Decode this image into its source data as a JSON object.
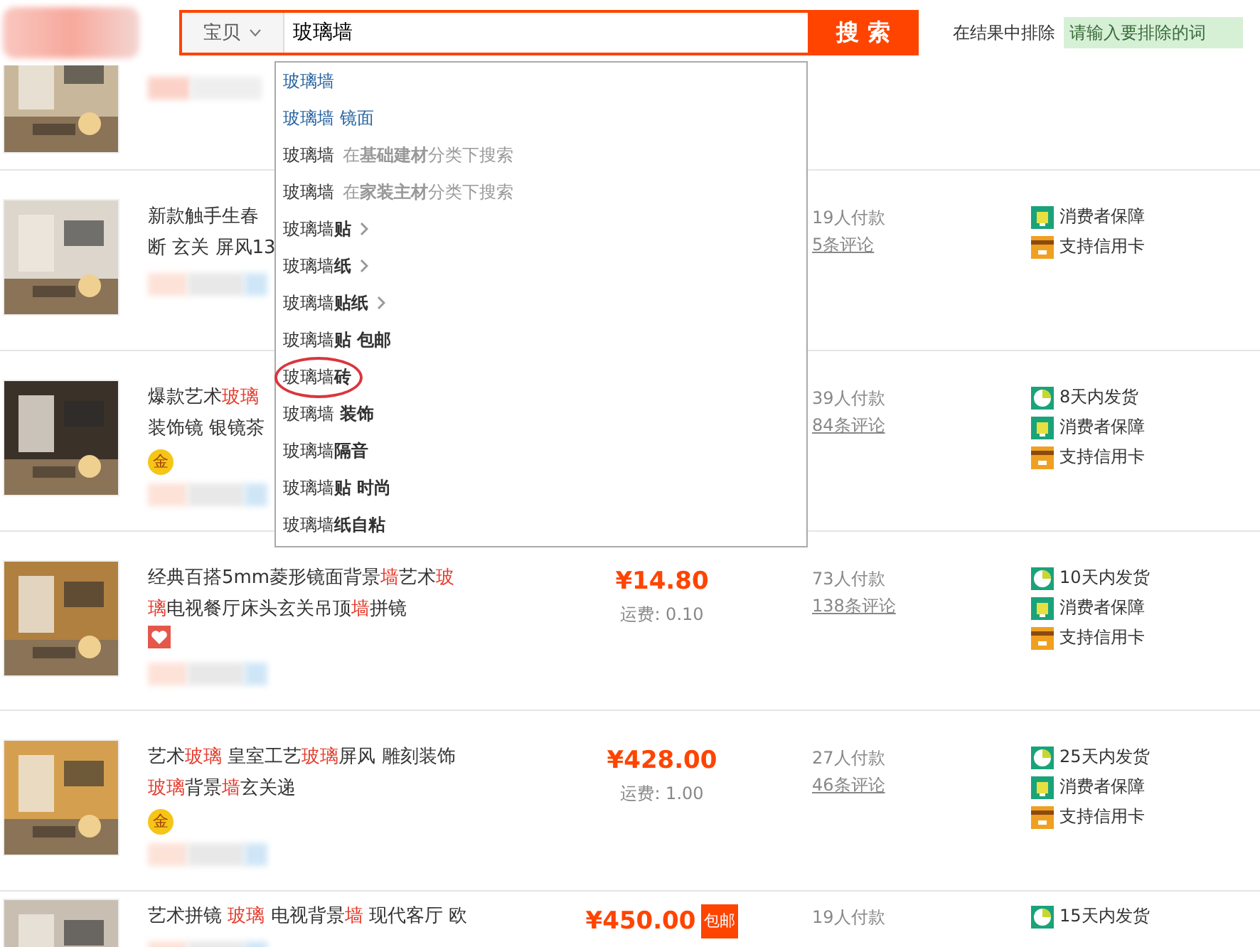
{
  "search": {
    "scope": "宝贝",
    "value": "玻璃墙",
    "button": "搜 索",
    "exclude_label": "在结果中排除",
    "exclude_placeholder": "请输入要排除的词"
  },
  "suggestions": [
    {
      "kind": "history",
      "text": "玻璃墙",
      "arrow": false,
      "circled": false
    },
    {
      "kind": "history",
      "text": "玻璃墙 镜面",
      "arrow": false,
      "circled": false
    },
    {
      "kind": "category",
      "text": "玻璃墙",
      "note": "在**基础建材**分类下搜索",
      "arrow": false,
      "circled": false
    },
    {
      "kind": "category",
      "text": "玻璃墙",
      "note": "在**家装主材**分类下搜索",
      "arrow": false,
      "circled": false
    },
    {
      "kind": "suggest",
      "text": "玻璃墙",
      "suffix": "贴",
      "arrow": true,
      "circled": false
    },
    {
      "kind": "suggest",
      "text": "玻璃墙",
      "suffix": "纸",
      "arrow": true,
      "circled": false
    },
    {
      "kind": "suggest",
      "text": "玻璃墙",
      "suffix": "贴纸",
      "arrow": true,
      "circled": false
    },
    {
      "kind": "suggest",
      "text": "玻璃墙",
      "suffix": "贴 包邮",
      "arrow": false,
      "circled": false
    },
    {
      "kind": "suggest",
      "text": "玻璃墙",
      "suffix": "砖",
      "arrow": false,
      "circled": true
    },
    {
      "kind": "suggest",
      "text": "玻璃墙",
      "suffix": " 装饰",
      "arrow": false,
      "circled": false
    },
    {
      "kind": "suggest",
      "text": "玻璃墙",
      "suffix": "隔音",
      "arrow": false,
      "circled": false
    },
    {
      "kind": "suggest",
      "text": "玻璃墙",
      "suffix": "贴 时尚",
      "arrow": false,
      "circled": false
    },
    {
      "kind": "suggest",
      "text": "玻璃墙",
      "suffix": "纸自粘",
      "arrow": false,
      "circled": false
    }
  ],
  "products": [
    {
      "kind": "partial"
    },
    {
      "kind": "item",
      "title": [
        [
          {
            "text": "新款触手生春",
            "hl": false
          }
        ],
        [
          {
            "text": "断 玄关 屏风13",
            "hl": false
          }
        ]
      ],
      "sales": "19人付款",
      "reviews": "5条评论",
      "services": [
        {
          "kind": "guarantee",
          "label": "消费者保障"
        },
        {
          "kind": "card",
          "label": "支持信用卡"
        }
      ]
    },
    {
      "kind": "item",
      "title": [
        [
          {
            "text": "爆款艺术",
            "hl": false
          },
          {
            "text": "玻璃",
            "hl": true
          }
        ],
        [
          {
            "text": "装饰镜 银镜茶",
            "hl": false
          }
        ]
      ],
      "badge": {
        "kind": "gold",
        "text": "金"
      },
      "sales": "39人付款",
      "reviews": "84条评论",
      "services": [
        {
          "kind": "shipping",
          "label": "8天内发货"
        },
        {
          "kind": "guarantee",
          "label": "消费者保障"
        },
        {
          "kind": "card",
          "label": "支持信用卡"
        }
      ]
    },
    {
      "kind": "item",
      "title": [
        [
          {
            "text": "经典百搭5mm菱形镜面背景",
            "hl": false
          },
          {
            "text": "墙",
            "hl": true
          },
          {
            "text": "艺术",
            "hl": false
          },
          {
            "text": "玻",
            "hl": true
          }
        ],
        [
          {
            "text": "璃",
            "hl": true
          },
          {
            "text": "电视餐厅床头玄关吊顶",
            "hl": false
          },
          {
            "text": "墙",
            "hl": true
          },
          {
            "text": "拼镜",
            "hl": false
          }
        ]
      ],
      "badge": {
        "kind": "heart"
      },
      "price": "¥14.80",
      "shipping_fee": "运费: 0.10",
      "sales": "73人付款",
      "reviews": "138条评论",
      "services": [
        {
          "kind": "shipping",
          "label": "10天内发货"
        },
        {
          "kind": "guarantee",
          "label": "消费者保障"
        },
        {
          "kind": "card",
          "label": "支持信用卡"
        }
      ]
    },
    {
      "kind": "item",
      "title": [
        [
          {
            "text": "艺术",
            "hl": false
          },
          {
            "text": "玻璃",
            "hl": true
          },
          {
            "text": " 皇室工艺",
            "hl": false
          },
          {
            "text": "玻璃",
            "hl": true
          },
          {
            "text": "屏风 雕刻装饰",
            "hl": false
          }
        ],
        [
          {
            "text": "玻璃",
            "hl": true
          },
          {
            "text": "背景",
            "hl": false
          },
          {
            "text": "墙",
            "hl": true
          },
          {
            "text": "玄关递",
            "hl": false
          }
        ]
      ],
      "badge": {
        "kind": "gold",
        "text": "金"
      },
      "price": "¥428.00",
      "shipping_fee": "运费: 1.00",
      "sales": "27人付款",
      "reviews": "46条评论",
      "services": [
        {
          "kind": "shipping",
          "label": "25天内发货"
        },
        {
          "kind": "guarantee",
          "label": "消费者保障"
        },
        {
          "kind": "card",
          "label": "支持信用卡"
        }
      ]
    },
    {
      "kind": "item",
      "title": [
        [
          {
            "text": "艺术拼镜 ",
            "hl": false
          },
          {
            "text": "玻璃",
            "hl": true
          },
          {
            "text": " 电视背景",
            "hl": false
          },
          {
            "text": "墙",
            "hl": true
          },
          {
            "text": " 现代客厅 欧",
            "hl": false
          }
        ]
      ],
      "price": "¥450.00",
      "free_shipping": "包邮",
      "sales": "19人付款",
      "services": [
        {
          "kind": "shipping",
          "label": "15天内发货"
        }
      ]
    }
  ]
}
